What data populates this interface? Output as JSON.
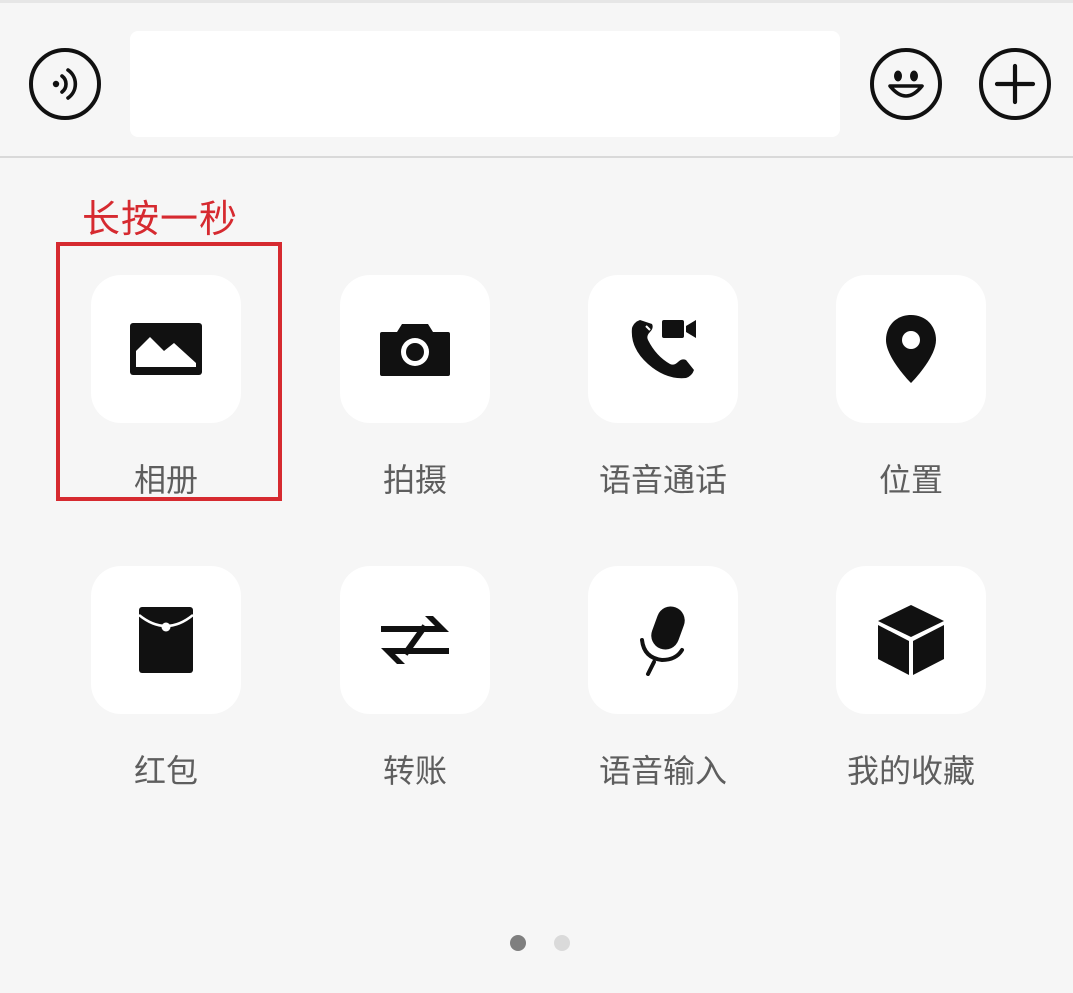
{
  "input_bar": {
    "voice_icon": "voice-input-icon",
    "text_value": "",
    "emoji_icon": "emoji-icon",
    "plus_icon": "plus-icon"
  },
  "annotation": {
    "text": "长按一秒",
    "color": "#d62a30"
  },
  "panel": {
    "items": [
      {
        "label": "相册",
        "icon": "photo-album-icon"
      },
      {
        "label": "拍摄",
        "icon": "camera-icon"
      },
      {
        "label": "语音通话",
        "icon": "voice-video-call-icon"
      },
      {
        "label": "位置",
        "icon": "location-pin-icon"
      },
      {
        "label": "红包",
        "icon": "red-packet-icon"
      },
      {
        "label": "转账",
        "icon": "transfer-icon"
      },
      {
        "label": "语音输入",
        "icon": "microphone-icon"
      },
      {
        "label": "我的收藏",
        "icon": "favorites-cube-icon"
      }
    ],
    "page_indicator": {
      "total": 2,
      "current": 1
    }
  }
}
